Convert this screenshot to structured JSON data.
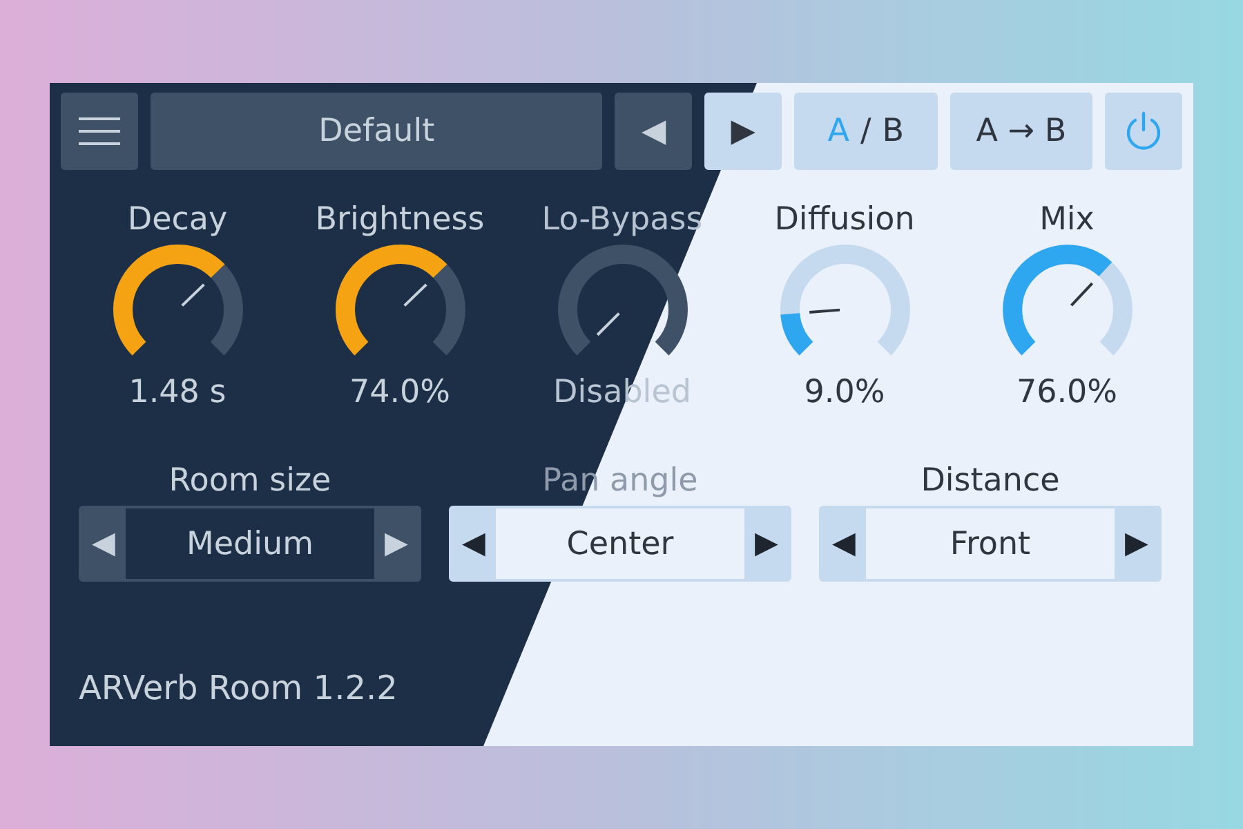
{
  "toolbar": {
    "preset": {
      "label": "Default"
    },
    "prev_button": {
      "label": "◀"
    },
    "next_button": {
      "label": "▶"
    },
    "ab_toggle": {
      "separator": "/",
      "options": [
        {
          "label": "A",
          "selected": true
        },
        {
          "label": "B",
          "selected": false
        }
      ]
    },
    "copy_button": {
      "label": "A → B"
    },
    "power_button": {
      "on": true
    }
  },
  "knobs": [
    {
      "label": "Decay",
      "value": "1.48 s"
    },
    {
      "label": "Brightness",
      "value": "74.0%"
    },
    {
      "label": "Lo-Bypass",
      "value": "Disabled"
    },
    {
      "label": "Diffusion",
      "value": "9.0%"
    },
    {
      "label": "Mix",
      "value": "76.0%"
    }
  ],
  "selectors": [
    {
      "label": "Room size",
      "value": "Medium",
      "prev": "◀",
      "next": "▶"
    },
    {
      "label": "Pan angle",
      "value": "Center",
      "prev": "◀",
      "next": "▶"
    },
    {
      "label": "Distance",
      "value": "Front",
      "prev": "◀",
      "next": "▶"
    }
  ],
  "footer": "ARVerb Room 1.2.2"
}
